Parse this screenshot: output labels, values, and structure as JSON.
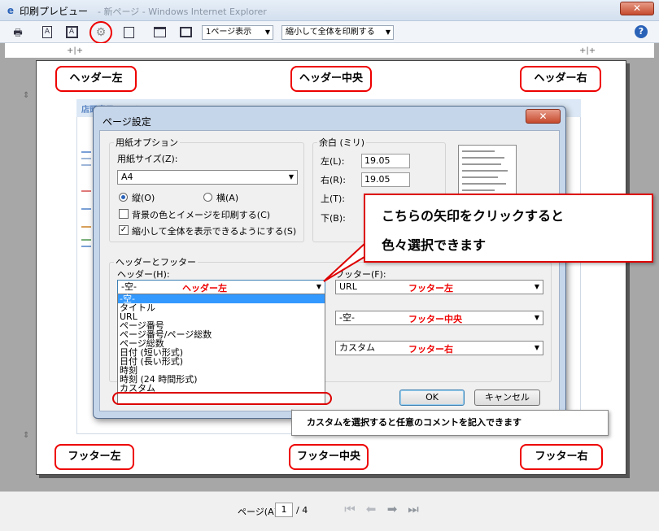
{
  "window": {
    "title": "印刷プレビュー",
    "title_ghost": "- 新ページ - Windows Internet Explorer",
    "close_glyph": "✕"
  },
  "toolbar": {
    "view_select": "1ページ表示",
    "shrink_select": "縮小して全体を印刷する",
    "help_glyph": "?"
  },
  "labels": {
    "header_left": "ヘッダー左",
    "header_center": "ヘッダー中央",
    "header_right": "ヘッダー右",
    "footer_left": "フッター左",
    "footer_center": "フッター中央",
    "footer_right": "フッター右"
  },
  "webpage": {
    "header_text": "店頭表示ページ"
  },
  "dialog": {
    "title": "ページ設定",
    "paper_group": "用紙オプション",
    "paper_size_label": "用紙サイズ(Z):",
    "paper_size_value": "A4",
    "orientation_portrait": "縦(O)",
    "orientation_landscape": "横(A)",
    "print_bg": "背景の色とイメージを印刷する(C)",
    "shrink_fit": "縮小して全体を表示できるようにする(S)",
    "margins_group": "余白 (ミリ)",
    "margin_left_label": "左(L):",
    "margin_left_value": "19.05",
    "margin_right_label": "右(R):",
    "margin_right_value": "19.05",
    "margin_top_label": "上(T):",
    "margin_bottom_label": "下(B):",
    "hf_group": "ヘッダーとフッター",
    "header_label": "ヘッダー(H):",
    "header_value": "-空-",
    "footer_label": "フッター(F):",
    "footer1_value": "URL",
    "footer2_value": "-空-",
    "footer3_value": "カスタム",
    "ok": "OK",
    "cancel": "キャンセル",
    "list_items": [
      "-空-",
      "タイトル",
      "URL",
      "ページ番号",
      "ページ番号/ページ総数",
      "ページ総数",
      "日付 (短い形式)",
      "日付 (長い形式)",
      "時刻",
      "時刻 (24 時間形式)",
      "カスタム"
    ]
  },
  "callouts": {
    "arrow_line1": "こちらの矢印をクリックすると",
    "arrow_line2": "色々選択できます",
    "custom_note": "カスタムを選択すると任意のコメントを記入できます"
  },
  "bottom": {
    "page_label": "ページ(A)",
    "page_value": "1",
    "page_total": "/ 4"
  },
  "colors": {
    "accent_red": "#e00000",
    "selection_blue": "#3399ff"
  }
}
